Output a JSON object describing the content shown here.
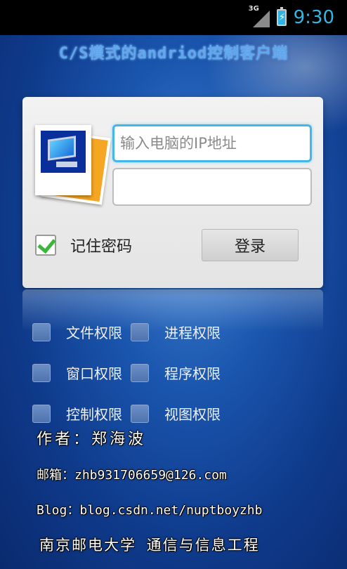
{
  "status_bar": {
    "network": "3G",
    "battery_icon": "battery-charging-icon",
    "time": "9:30"
  },
  "app": {
    "title": "C/S模式的andriod控制客户端"
  },
  "login": {
    "ip_placeholder": "输入电脑的IP地址",
    "ip_value": "",
    "password_value": "",
    "remember_label": "记住密码",
    "remember_checked": true,
    "login_button": "登录"
  },
  "permissions": [
    {
      "label": "文件权限",
      "checked": false
    },
    {
      "label": "进程权限",
      "checked": false
    },
    {
      "label": "窗口权限",
      "checked": false
    },
    {
      "label": "程序权限",
      "checked": false
    },
    {
      "label": "控制权限",
      "checked": false
    },
    {
      "label": "视图权限",
      "checked": false
    }
  ],
  "info": {
    "author": "作者：郑海波",
    "email": "邮箱：zhb931706659@126.com",
    "blog": "Blog：blog.csdn.net/nuptboyzhb",
    "school": "南京邮电大学 通信与信息工程"
  },
  "colors": {
    "accent": "#33b5e5",
    "background": "#1a55ad",
    "check": "#3ab73a"
  }
}
